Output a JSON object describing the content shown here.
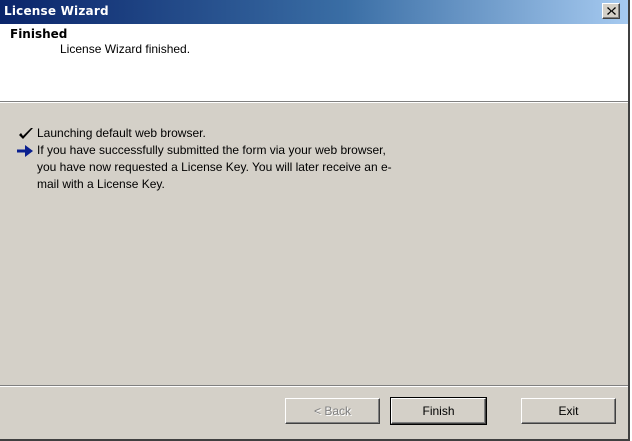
{
  "window": {
    "title": "License Wizard",
    "close_label": "close"
  },
  "header": {
    "title": "Finished",
    "subtitle": "License Wizard finished."
  },
  "content": {
    "items": [
      {
        "icon": "checkmark-icon",
        "lines": [
          "Launching default web browser."
        ]
      },
      {
        "icon": "arrow-right-icon",
        "lines": [
          "If you have successfully submitted the form via your web browser,",
          "you have now requested a License Key. You will later receive an e-",
          "mail with a License Key."
        ]
      }
    ]
  },
  "buttons": {
    "back": "< Back",
    "finish": "Finish",
    "exit": "Exit"
  },
  "colors": {
    "title_bar_start": "#0a246a",
    "title_bar_end": "#a6caf0",
    "dialog_bg": "#d4d0c8",
    "arrow_color": "#0a1f8f"
  }
}
